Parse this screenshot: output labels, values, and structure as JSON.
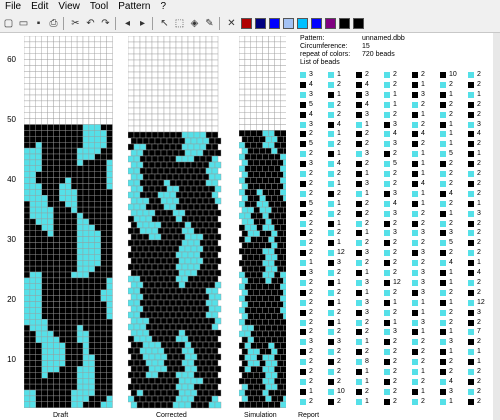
{
  "menu": [
    "File",
    "Edit",
    "View",
    "Tool",
    "Pattern",
    "?"
  ],
  "toolbar": {
    "icons": [
      "new-file-icon",
      "open-folder-icon",
      "save-icon",
      "print-icon",
      "cut-icon",
      "undo-icon",
      "redo-icon",
      "arrow-left-icon",
      "arrow-right-icon",
      "pointer-icon",
      "select-rect-icon",
      "fill-icon",
      "pipette-icon",
      "cross-color-icon"
    ],
    "colors": [
      "#b00000",
      "#000080",
      "#0000ff",
      "#a4c2f4",
      "#00c0ff",
      "#0000ff",
      "#800080",
      "#000000",
      "#000000"
    ]
  },
  "colors": {
    "cyan": "#55e0e8",
    "black": "#000000",
    "white": "#ffffff",
    "grid": "#9a9a9a"
  },
  "row_labels": [
    "60",
    "50",
    "40",
    "30",
    "20",
    "10"
  ],
  "captions": {
    "draft": "Draft",
    "corrected": "Corrected",
    "simulation": "Simulation",
    "report": "Report"
  },
  "info": {
    "pattern_label": "Pattern:",
    "pattern_value": "unnamed.dbb",
    "circ_label": "Circumference:",
    "circ_value": "15",
    "repeat_label": "repeat of colors:",
    "repeat_value": "720 beads",
    "list_label": "List of beads"
  },
  "report": [
    [
      "c",
      "3",
      "c",
      "1",
      "k",
      "2",
      "c",
      "2",
      "k",
      "2",
      "k",
      "10",
      "c",
      "2"
    ],
    [
      "k",
      "4",
      "c",
      "2",
      "k",
      "4",
      "c",
      "2",
      "k",
      "1",
      "c",
      "2",
      "k",
      "2"
    ],
    [
      "c",
      "3",
      "k",
      "1",
      "k",
      "3",
      "c",
      "1",
      "k",
      "3",
      "k",
      "1",
      "c",
      "1"
    ],
    [
      "k",
      "5",
      "c",
      "2",
      "k",
      "4",
      "c",
      "1",
      "c",
      "2",
      "k",
      "2",
      "k",
      "2"
    ],
    [
      "k",
      "4",
      "c",
      "2",
      "k",
      "3",
      "c",
      "2",
      "k",
      "1",
      "c",
      "2",
      "k",
      "2"
    ],
    [
      "c",
      "3",
      "k",
      "4",
      "c",
      "1",
      "k",
      "3",
      "c",
      "2",
      "k",
      "1",
      "c",
      "3"
    ],
    [
      "k",
      "2",
      "c",
      "1",
      "k",
      "2",
      "c",
      "4",
      "k",
      "4",
      "c",
      "1",
      "k",
      "4"
    ],
    [
      "k",
      "5",
      "c",
      "2",
      "k",
      "2",
      "c",
      "3",
      "k",
      "2",
      "c",
      "1",
      "k",
      "2"
    ],
    [
      "c",
      "2",
      "k",
      "1",
      "c",
      "3",
      "k",
      "2",
      "c",
      "1",
      "c",
      "5",
      "k",
      "1"
    ],
    [
      "k",
      "3",
      "c",
      "4",
      "k",
      "2",
      "c",
      "5",
      "k",
      "1",
      "k",
      "2",
      "k",
      "2"
    ],
    [
      "c",
      "2",
      "c",
      "2",
      "k",
      "1",
      "c",
      "2",
      "k",
      "1",
      "c",
      "2",
      "c",
      "2"
    ],
    [
      "k",
      "2",
      "c",
      "1",
      "k",
      "3",
      "c",
      "2",
      "k",
      "4",
      "c",
      "2",
      "k",
      "2"
    ],
    [
      "c",
      "2",
      "k",
      "2",
      "c",
      "1",
      "k",
      "3",
      "c",
      "1",
      "k",
      "4",
      "c",
      "2"
    ],
    [
      "k",
      "5",
      "c",
      "1",
      "k",
      "2",
      "c",
      "4",
      "k",
      "1",
      "c",
      "2",
      "k",
      "1"
    ],
    [
      "k",
      "2",
      "c",
      "2",
      "k",
      "2",
      "c",
      "3",
      "c",
      "2",
      "k",
      "1",
      "c",
      "3"
    ],
    [
      "c",
      "2",
      "k",
      "1",
      "c",
      "2",
      "k",
      "2",
      "k",
      "2",
      "c",
      "2",
      "k",
      "2"
    ],
    [
      "k",
      "2",
      "c",
      "2",
      "k",
      "1",
      "c",
      "3",
      "c",
      "3",
      "k",
      "3",
      "c",
      "2"
    ],
    [
      "c",
      "2",
      "k",
      "1",
      "c",
      "2",
      "k",
      "2",
      "c",
      "2",
      "c",
      "5",
      "k",
      "2"
    ],
    [
      "k",
      "2",
      "c",
      "12",
      "k",
      "3",
      "c",
      "2",
      "k",
      "3",
      "k",
      "2",
      "c",
      "2"
    ],
    [
      "c",
      "1",
      "k",
      "3",
      "c",
      "2",
      "k",
      "2",
      "c",
      "2",
      "c",
      "4",
      "k",
      "1"
    ],
    [
      "k",
      "3",
      "c",
      "2",
      "k",
      "1",
      "c",
      "2",
      "c",
      "3",
      "k",
      "1",
      "k",
      "4"
    ],
    [
      "c",
      "2",
      "k",
      "1",
      "c",
      "3",
      "k",
      "12",
      "c",
      "3",
      "k",
      "1",
      "c",
      "2"
    ],
    [
      "k",
      "2",
      "c",
      "2",
      "k",
      "1",
      "c",
      "2",
      "k",
      "3",
      "c",
      "2",
      "k",
      "2"
    ],
    [
      "c",
      "2",
      "k",
      "1",
      "c",
      "3",
      "k",
      "1",
      "c",
      "1",
      "k",
      "1",
      "c",
      "12"
    ],
    [
      "k",
      "2",
      "c",
      "2",
      "k",
      "3",
      "c",
      "2",
      "k",
      "1",
      "c",
      "2",
      "k",
      "3"
    ],
    [
      "c",
      "2",
      "k",
      "1",
      "c",
      "2",
      "k",
      "1",
      "c",
      "3",
      "c",
      "2",
      "k",
      "2"
    ],
    [
      "k",
      "2",
      "c",
      "2",
      "k",
      "2",
      "c",
      "3",
      "k",
      "1",
      "k",
      "1",
      "c",
      "7"
    ],
    [
      "c",
      "3",
      "k",
      "3",
      "c",
      "1",
      "k",
      "2",
      "c",
      "2",
      "c",
      "3",
      "k",
      "2"
    ],
    [
      "k",
      "2",
      "c",
      "2",
      "k",
      "2",
      "c",
      "2",
      "k",
      "2",
      "k",
      "1",
      "c",
      "1"
    ],
    [
      "c",
      "2",
      "k",
      "2",
      "c",
      "8",
      "k",
      "2",
      "c",
      "2",
      "k",
      "2",
      "k",
      "1"
    ],
    [
      "k",
      "2",
      "c",
      "2",
      "k",
      "1",
      "c",
      "2",
      "c",
      "1",
      "k",
      "2",
      "c",
      "2"
    ],
    [
      "c",
      "2",
      "k",
      "2",
      "c",
      "1",
      "k",
      "2",
      "c",
      "2",
      "c",
      "4",
      "k",
      "2"
    ],
    [
      "k",
      "1",
      "c",
      "10",
      "k",
      "2",
      "c",
      "2",
      "k",
      "1",
      "k",
      "3",
      "c",
      "2"
    ],
    [
      "c",
      "2",
      "k",
      "2",
      "c",
      "1",
      "k",
      "2",
      "c",
      "2",
      "c",
      "1",
      "k",
      "2"
    ]
  ]
}
